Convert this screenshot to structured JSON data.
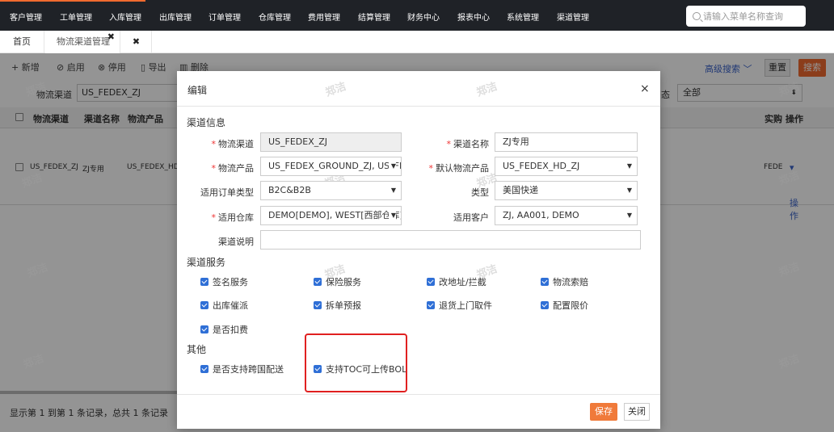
{
  "nav": {
    "items": [
      "客户管理",
      "工单管理",
      "入库管理",
      "出库管理",
      "订单管理",
      "仓库管理",
      "费用管理",
      "结算管理",
      "财务中心",
      "报表中心",
      "系统管理",
      "渠道管理"
    ],
    "search_placeholder": "请输入菜单名称查询"
  },
  "tabs": {
    "home": "首页",
    "active": "物流渠道管理",
    "close_all": "✖"
  },
  "toolbar": {
    "add": "+ 新增",
    "enable": "⊘ 启用",
    "disable": "⊗ 停用",
    "export": "导出",
    "delete": "删除",
    "advanced_search": "高级搜索",
    "reset": "重置",
    "search": "搜索"
  },
  "filter": {
    "channel_label": "物流渠道",
    "channel_value": "US_FEDEX_ZJ",
    "status_label": "态",
    "status_value": "全部"
  },
  "grid": {
    "headers": [
      "物流渠道",
      "渠道名称",
      "物流产品",
      "实购",
      "操作"
    ],
    "row": [
      "US_FEDEX_ZJ",
      "ZJ专用",
      "US_FEDEX_HD_Z",
      "FEDE",
      "操作"
    ],
    "footer": "显示第 1 到第 1 条记录，总共 1 条记录"
  },
  "watermark": "郑洁",
  "modal": {
    "title": "编辑",
    "close": "×",
    "section_channel": "渠道信息",
    "section_service": "渠道服务",
    "section_other": "其他",
    "fields": {
      "channel_label": "物流渠道",
      "channel_value": "US_FEDEX_ZJ",
      "name_label": "渠道名称",
      "name_value": "ZJ专用",
      "product_label": "物流产品",
      "product_value": "US_FEDEX_GROUND_ZJ, US_FED",
      "default_product_label": "默认物流产品",
      "default_product_value": "US_FEDEX_HD_ZJ",
      "order_type_label": "适用订单类型",
      "order_type_value": "B2C&B2B",
      "type_label": "类型",
      "type_value": "美国快递",
      "warehouse_label": "适用仓库",
      "warehouse_value": "DEMO[DEMO], WEST[西部仓库]",
      "customer_label": "适用客户",
      "customer_value": "ZJ, AA001, DEMO",
      "desc_label": "渠道说明",
      "desc_value": ""
    },
    "services": [
      "签名服务",
      "保险服务",
      "改地址/拦截",
      "物流索赔",
      "出库催派",
      "拆单预报",
      "退货上门取件",
      "配置限价",
      "是否扣费"
    ],
    "others": [
      "是否支持跨国配送",
      "支持TOC可上传BOL"
    ],
    "save": "保存",
    "close_button": "关闭"
  }
}
